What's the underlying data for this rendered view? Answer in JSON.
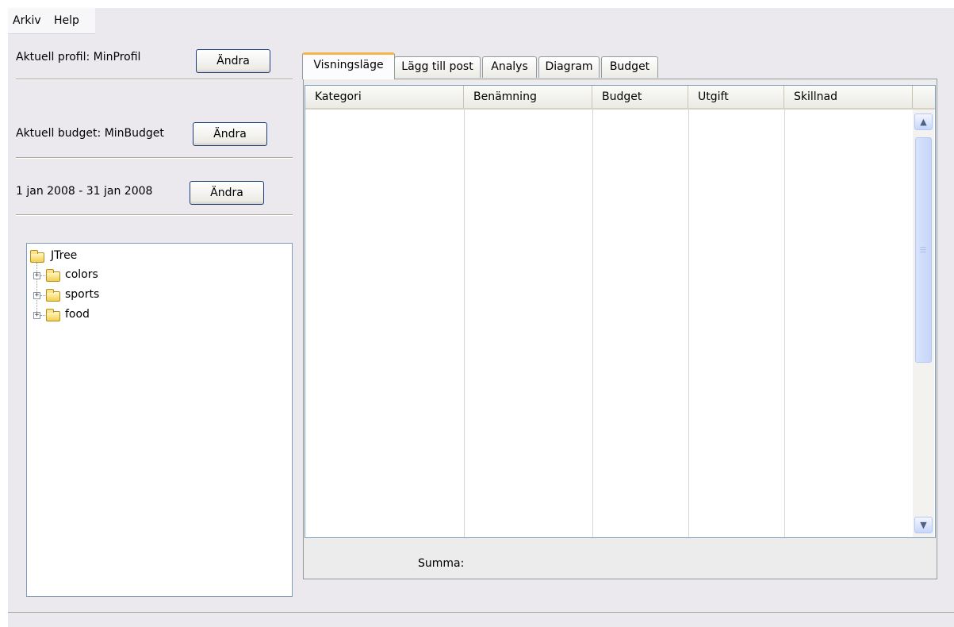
{
  "menu": {
    "items": [
      "Arkiv",
      "Help"
    ]
  },
  "left_panel": {
    "profile_label": "Aktuell profil: MinProfil",
    "budget_label": "Aktuell budget: MinBudget",
    "period_label": "1 jan 2008 - 31 jan 2008",
    "change_button": "Ändra"
  },
  "tree": {
    "root": "JTree",
    "children": [
      "colors",
      "sports",
      "food"
    ]
  },
  "tabs": [
    "Visningsläge",
    "Lägg till post",
    "Analys",
    "Diagram",
    "Budget"
  ],
  "active_tab": "Visningsläge",
  "table": {
    "columns": [
      "Kategori",
      "Benämning",
      "Budget",
      "Utgift",
      "Skillnad"
    ],
    "rows": []
  },
  "summary_label": "Summa:",
  "icons": {
    "folder": "folder-icon",
    "expand": "plus-expander-icon",
    "scroll_up": "chevron-up-icon",
    "scroll_down": "chevron-down-icon"
  },
  "colors": {
    "active_tab_accent": "#f7b44a",
    "button_border": "#1c3d7c",
    "window_background": "#ebe9ed"
  }
}
